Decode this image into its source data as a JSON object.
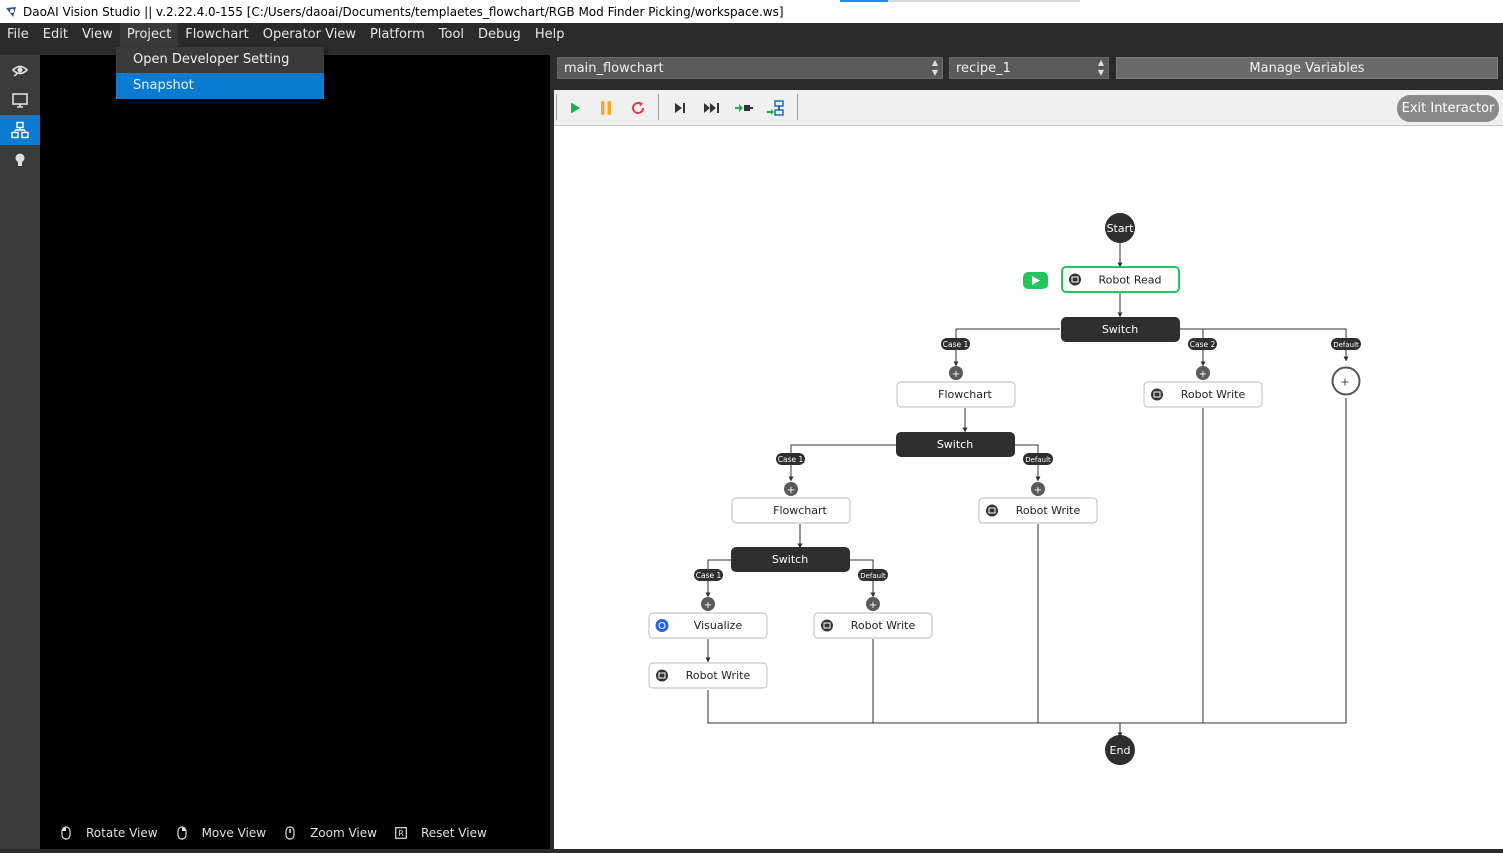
{
  "window": {
    "title": "DaoAI Vision Studio || v.2.22.4.0-155  [C:/Users/daoai/Documents/templaetes_flowchart/RGB Mod Finder Picking/workspace.ws]"
  },
  "menu": {
    "items": [
      "File",
      "Edit",
      "View",
      "Project",
      "Flowchart",
      "Operator View",
      "Platform",
      "Tool",
      "Debug",
      "Help"
    ],
    "open_menu": "Project",
    "dropdown": [
      "Open Developer Setting",
      "Snapshot"
    ],
    "dropdown_selected": "Snapshot"
  },
  "sidebar": {
    "icons": [
      "eye-rotate-icon",
      "monitor-icon",
      "flowchart-icon",
      "lightbulb-icon"
    ],
    "active": "flowchart-icon"
  },
  "viewport": {
    "hints": [
      {
        "icon": "mouse-left-icon",
        "label": "Rotate View"
      },
      {
        "icon": "mouse-right-icon",
        "label": "Move View"
      },
      {
        "icon": "mouse-wheel-icon",
        "label": "Zoom View"
      },
      {
        "icon": "r-key-icon",
        "label": "Reset View"
      }
    ]
  },
  "flowchart_panel": {
    "flowchart_select": "main_flowchart",
    "recipe_select": "recipe_1",
    "manage_variables": "Manage Variables",
    "exit_interactor": "Exit Interactor",
    "toolbar": [
      "play-icon",
      "pause-icon",
      "restart-icon",
      "step-icon",
      "step-all-icon",
      "breakpoint-icon",
      "connect-icon"
    ],
    "colors": {
      "play": "#17b34a",
      "pause": "#f5a623",
      "restart": "#e23b3b",
      "node_dark": "#2f2f2f",
      "active_border": "#22c55e"
    }
  },
  "flow": {
    "start": "Start",
    "end": "End",
    "nodes": {
      "robot_read": "Robot Read",
      "switch_1": "Switch",
      "switch_2": "Switch",
      "switch_3": "Switch",
      "flowchart_1": "Flowchart",
      "flowchart_2": "Flowchart",
      "visualize": "Visualize",
      "robot_write_1": "Robot Write",
      "robot_write_2": "Robot Write",
      "robot_write_3": "Robot Write",
      "robot_write_4": "Robot Write"
    },
    "cases": {
      "s1_case1": "Case 1",
      "s1_case2": "Case 2",
      "s1_default": "Default",
      "s2_case1": "Case 1",
      "s2_default": "Default",
      "s3_case1": "Case 1",
      "s3_default": "Default"
    },
    "add_symbol": "+"
  }
}
